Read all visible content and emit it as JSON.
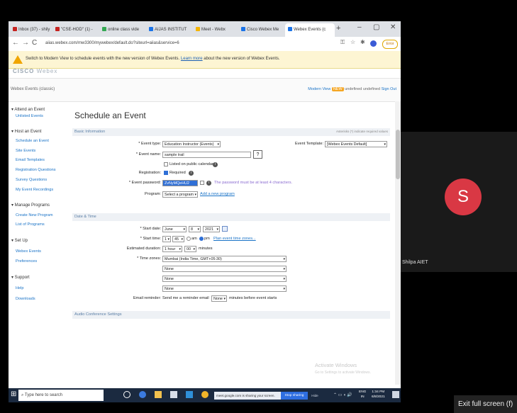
{
  "browser": {
    "tabs": [
      {
        "label": "Inbox (37) - shily",
        "color": "#c5221f"
      },
      {
        "label": "\"CSE-HOD\" (1) -",
        "color": "#c5221f"
      },
      {
        "label": "online class vide",
        "color": "#34a853"
      },
      {
        "label": "AIJAS INSTITUT",
        "color": "#1a73e8"
      },
      {
        "label": "Meet - Webx",
        "color": "#f4b400"
      },
      {
        "label": "Cisco Webex Me",
        "color": "#1a73e8"
      },
      {
        "label": "Webex Events (c",
        "color": "#1a73e8",
        "active": true
      }
    ],
    "new_tab": "+",
    "window_controls": [
      "–",
      "▢",
      "✕"
    ],
    "url": "aiias.webex.com/mw3300/mywebex/default.do?siteurl=aiias&service=6",
    "error_button": "Error",
    "nav": {
      "back": "←",
      "forward": "→",
      "reload": "C"
    }
  },
  "banner": {
    "text": "Switch to Modern View to schedule events with the new version of Webex Events.",
    "link": "Learn more",
    "text_after": "about the new version of Webex Events."
  },
  "logo": {
    "brand": "CISCO",
    "product": "Webex"
  },
  "header": {
    "site_label": "Webex Events (classic)",
    "modern_view": "Modern View",
    "new_badge": "NEW",
    "user": "undefined undefined",
    "sign_out": "Sign Out"
  },
  "sidebar": {
    "sections": [
      {
        "label": "▾ Attend an Event",
        "items": [
          "Unlisted Events"
        ]
      },
      {
        "label": "▾ Host an Event",
        "items": [
          "Schedule an Event",
          "Site Events",
          "Email Templates",
          "Registration Questions",
          "Survey Questions",
          "My Event Recordings"
        ]
      },
      {
        "label": "▾ Manage Programs",
        "items": [
          "Create New Program",
          "List of Programs"
        ]
      },
      {
        "label": "▾ Set Up",
        "items": [
          "Webex Events",
          "Preferences"
        ]
      },
      {
        "label": "▾ Support",
        "items": [
          "Help",
          "Downloads"
        ]
      }
    ]
  },
  "main": {
    "title": "Schedule an Event",
    "basic_info_label": "Basic Information",
    "required_note": "Asterisks (*) indicate required values",
    "event_type_label": "* Event type:",
    "event_type_value": "Education Instructor (Events)",
    "event_template_label": "Event Template:",
    "event_template_value": "[Webex Events Default]",
    "event_name_label": "* Event name:",
    "event_name_value": "sample trail",
    "help_glyph": "?",
    "listed_label": "Listed on public calendar",
    "registration_label": "Registration:",
    "registration_value": "Required",
    "password_label": "* Event password:",
    "password_value": "ZvNyMQeHU2",
    "password_hint": "The password must be at least 4 characters.",
    "program_label": "Program:",
    "program_value": "Select a program",
    "add_program": "Add a new program",
    "date_time_label": "Date & Time",
    "start_date_label": "* Start date:",
    "start_month": "June",
    "start_day": "8",
    "start_year": "2021",
    "start_time_label": "* Start time:",
    "start_hour": "1",
    "start_minute": "45",
    "am_label": "am",
    "pm_label": "pm",
    "plan_link": "Plan event time zones...",
    "duration_label": "Estimated duration:",
    "duration_hour": "1 hour",
    "duration_min": "00",
    "minutes_label": "minutes",
    "timezones_label": "* Time zones:",
    "tz1": "Mumbai (India Time, GMT+05:30)",
    "tz2": "None",
    "tz3": "None",
    "tz4": "None",
    "reminder_label": "Email reminder:",
    "reminder_text": "Send me a reminder email",
    "reminder_value": "None",
    "reminder_after": "minutes before event starts",
    "audio_label": "Audio Conference Settings"
  },
  "windows_notice": {
    "title": "Activate Windows",
    "subtitle": "Go to Settings to activate Windows."
  },
  "taskbar": {
    "search_placeholder": "Type here to search",
    "share_text": "meet.google.com is sharing your screen.",
    "stop_sharing": "Stop sharing",
    "hide": "Hide",
    "lang": "ENG",
    "region": "IN",
    "time": "1:34 PM",
    "date": "6/8/2021"
  },
  "participant": {
    "initial": "S",
    "name": "Shilpa AIET",
    "avatar_color": "#d93844"
  },
  "exit_fullscreen": "Exit full screen (f)"
}
